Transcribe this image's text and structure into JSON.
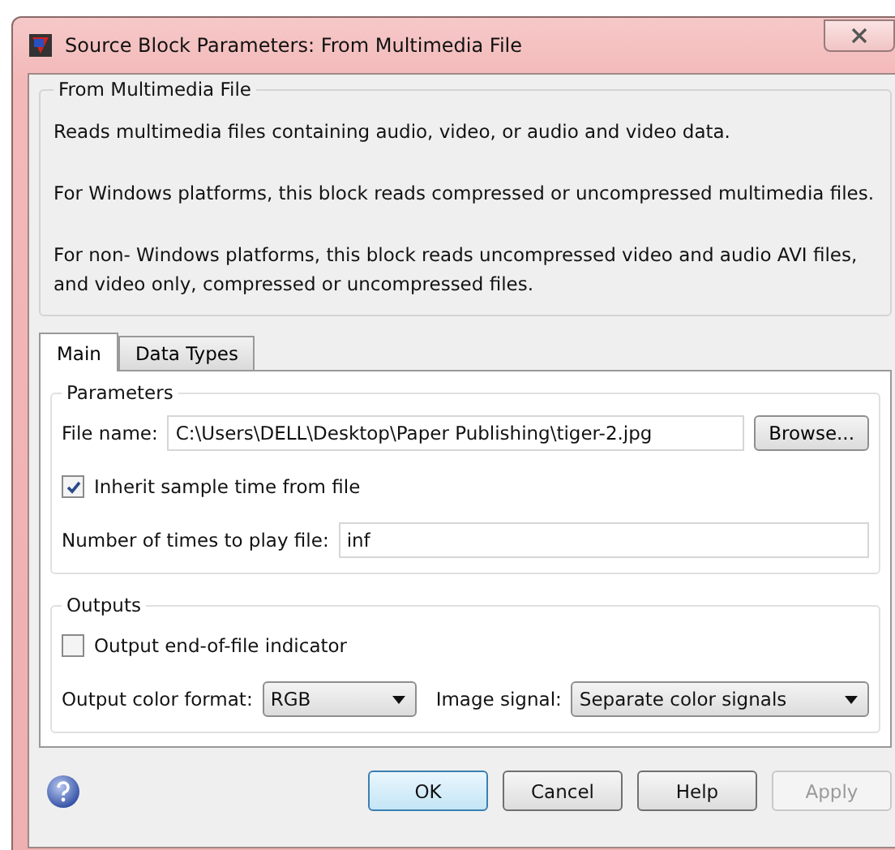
{
  "window": {
    "title": "Source Block Parameters: From Multimedia File"
  },
  "description": {
    "title": "From Multimedia File",
    "paragraphs": [
      "Reads multimedia files containing audio, video, or audio and video data.",
      "For Windows platforms, this block reads compressed or uncompressed multimedia files.",
      "For non- Windows platforms, this block reads uncompressed video and audio AVI files, and video only, compressed or uncompressed files."
    ]
  },
  "tabs": [
    {
      "label": "Main",
      "selected": true
    },
    {
      "label": "Data Types",
      "selected": false
    }
  ],
  "parameters": {
    "title": "Parameters",
    "file_name": {
      "label": "File name:",
      "value": "C:\\Users\\DELL\\Desktop\\Paper Publishing\\tiger-2.jpg"
    },
    "browse_button": "Browse...",
    "inherit": {
      "label": "Inherit sample time from file",
      "checked": true
    },
    "play_times": {
      "label": "Number of times to play file:",
      "value": "inf"
    }
  },
  "outputs": {
    "title": "Outputs",
    "eof": {
      "label": "Output end-of-file indicator",
      "checked": false
    },
    "color_format": {
      "label": "Output color format:",
      "value": "RGB"
    },
    "image_signal": {
      "label": "Image signal:",
      "value": "Separate color signals"
    }
  },
  "buttons": [
    {
      "label": "OK",
      "default": true,
      "disabled": false
    },
    {
      "label": "Cancel",
      "default": false,
      "disabled": false
    },
    {
      "label": "Help",
      "default": false,
      "disabled": false
    },
    {
      "label": "Apply",
      "default": false,
      "disabled": true
    }
  ]
}
